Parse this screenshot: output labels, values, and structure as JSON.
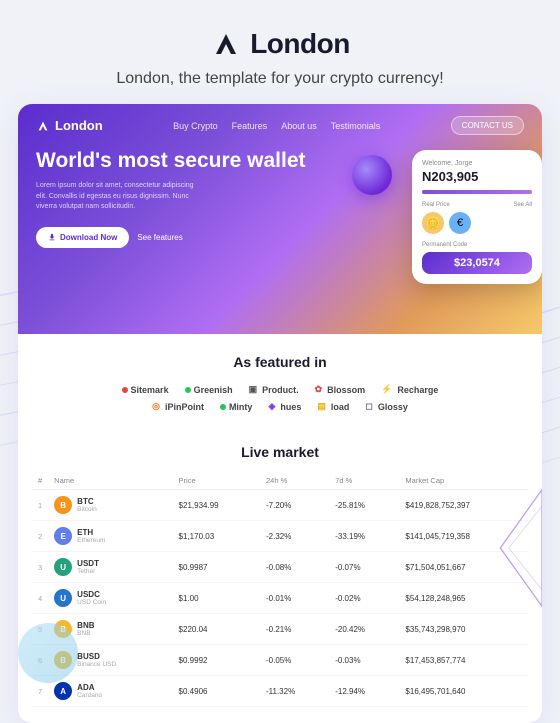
{
  "header": {
    "logo_text": "London",
    "subtitle": "London, the template for your crypto currency!"
  },
  "nav": {
    "logo": "London",
    "links": [
      "Buy Crypto",
      "Features",
      "About us",
      "Testimonials"
    ],
    "contact_btn": "CONTACT US"
  },
  "hero": {
    "title": "World's most secure wallet",
    "description": "Lorem ipsum dolor sit amet, consectetur adipiscing elit. Convallis id egestas eu risus dignissim. Nunc viverra volutpat nam sollicitudin.",
    "btn_download": "Download Now",
    "btn_features": "See features",
    "phone_welcome": "Welcome, Jorge",
    "phone_balance": "N203,905",
    "phone_label_real_price": "Real Price",
    "phone_label_see_all": "See All",
    "phone_label_permanent": "Permanent Code",
    "phone_price": "$23,0574"
  },
  "featured": {
    "title": "As featured in",
    "logos": [
      {
        "name": "Sitemark",
        "color": "#e84343"
      },
      {
        "name": "Greenish",
        "color": "#22c55e"
      },
      {
        "name": "Product.",
        "color": "#333"
      },
      {
        "name": "Blossom",
        "color": "#e84343"
      },
      {
        "name": "Recharge",
        "color": "#2563eb"
      },
      {
        "name": "iPinPoint",
        "color": "#f97316"
      },
      {
        "name": "Minty",
        "color": "#22c55e"
      },
      {
        "name": "hues",
        "color": "#7c3aed"
      },
      {
        "name": "load",
        "color": "#eab308"
      },
      {
        "name": "Glossy",
        "color": "#6b7280"
      }
    ]
  },
  "market": {
    "title": "Live market",
    "columns": [
      "Name",
      "Price",
      "24h %",
      "7d %",
      "Market Cap"
    ],
    "rows": [
      {
        "rank": 1,
        "symbol": "BTC",
        "name": "Bitcoin",
        "color": "#f7931a",
        "price": "$21,934.99",
        "h24": "-7.20%",
        "d7": "-25.81%",
        "mcap": "$419,828,752,397",
        "h24_neg": true,
        "d7_neg": true
      },
      {
        "rank": 2,
        "symbol": "ETH",
        "name": "Ethereum",
        "color": "#627eea",
        "price": "$1,170.03",
        "h24": "-2.32%",
        "d7": "-33.19%",
        "mcap": "$141,045,719,358",
        "h24_neg": true,
        "d7_neg": true
      },
      {
        "rank": 3,
        "symbol": "USDT",
        "name": "Tether",
        "color": "#26a17b",
        "price": "$0.9987",
        "h24": "-0.08%",
        "d7": "-0.07%",
        "mcap": "$71,504,051,667",
        "h24_neg": true,
        "d7_neg": true
      },
      {
        "rank": 4,
        "symbol": "USDC",
        "name": "USD Coin",
        "color": "#2775ca",
        "price": "$1.00",
        "h24": "-0.01%",
        "d7": "-0.02%",
        "mcap": "$54,128,248,965",
        "h24_neg": true,
        "d7_neg": true
      },
      {
        "rank": 5,
        "symbol": "BNB",
        "name": "BNB",
        "color": "#f3ba2f",
        "price": "$220.04",
        "h24": "-0.21%",
        "d7": "-20.42%",
        "mcap": "$35,743,298,970",
        "h24_neg": true,
        "d7_neg": true
      },
      {
        "rank": 6,
        "symbol": "BUSD",
        "name": "Binance USD",
        "color": "#f3ba2f",
        "price": "$0.9992",
        "h24": "-0.05%",
        "d7": "-0.03%",
        "mcap": "$17,453,857,774",
        "h24_neg": true,
        "d7_neg": true
      },
      {
        "rank": 7,
        "symbol": "ADA",
        "name": "Cardano",
        "color": "#0033ad",
        "price": "$0.4906",
        "h24": "-11.32%",
        "d7": "-12.94%",
        "mcap": "$16,495,701,640",
        "h24_neg": true,
        "d7_neg": true
      }
    ]
  }
}
